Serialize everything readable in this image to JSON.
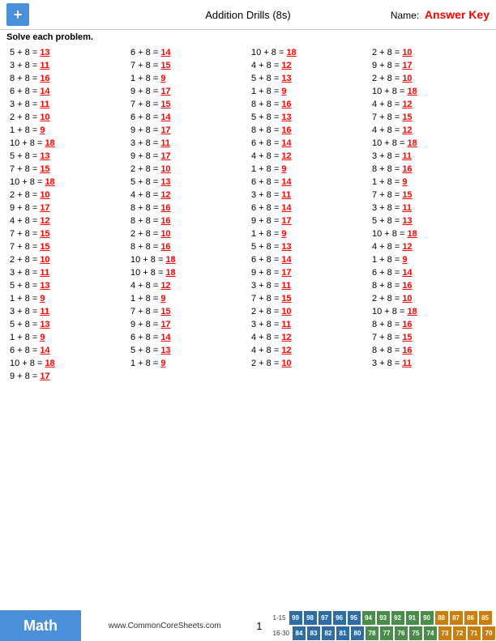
{
  "header": {
    "title": "Addition Drills (8s)",
    "name_label": "Name:",
    "answer_key": "Answer Key",
    "logo_symbol": "+"
  },
  "instruction": "Solve each problem.",
  "problems": [
    {
      "eq": "5 + 8 =",
      "ans": "13"
    },
    {
      "eq": "6 + 8 =",
      "ans": "14"
    },
    {
      "eq": "10 + 8 =",
      "ans": "18"
    },
    {
      "eq": "2 + 8 =",
      "ans": "10"
    },
    {
      "eq": "3 + 8 =",
      "ans": "11"
    },
    {
      "eq": "7 + 8 =",
      "ans": "15"
    },
    {
      "eq": "4 + 8 =",
      "ans": "12"
    },
    {
      "eq": "9 + 8 =",
      "ans": "17"
    },
    {
      "eq": "8 + 8 =",
      "ans": "16"
    },
    {
      "eq": "1 + 8 =",
      "ans": "9"
    },
    {
      "eq": "5 + 8 =",
      "ans": "13"
    },
    {
      "eq": "2 + 8 =",
      "ans": "10"
    },
    {
      "eq": "6 + 8 =",
      "ans": "14"
    },
    {
      "eq": "9 + 8 =",
      "ans": "17"
    },
    {
      "eq": "1 + 8 =",
      "ans": "9"
    },
    {
      "eq": "10 + 8 =",
      "ans": "18"
    },
    {
      "eq": "3 + 8 =",
      "ans": "11"
    },
    {
      "eq": "7 + 8 =",
      "ans": "15"
    },
    {
      "eq": "8 + 8 =",
      "ans": "16"
    },
    {
      "eq": "4 + 8 =",
      "ans": "12"
    },
    {
      "eq": "2 + 8 =",
      "ans": "10"
    },
    {
      "eq": "6 + 8 =",
      "ans": "14"
    },
    {
      "eq": "5 + 8 =",
      "ans": "13"
    },
    {
      "eq": "7 + 8 =",
      "ans": "15"
    },
    {
      "eq": "1 + 8 =",
      "ans": "9"
    },
    {
      "eq": "9 + 8 =",
      "ans": "17"
    },
    {
      "eq": "8 + 8 =",
      "ans": "16"
    },
    {
      "eq": "4 + 8 =",
      "ans": "12"
    },
    {
      "eq": "10 + 8 =",
      "ans": "18"
    },
    {
      "eq": "3 + 8 =",
      "ans": "11"
    },
    {
      "eq": "6 + 8 =",
      "ans": "14"
    },
    {
      "eq": "10 + 8 =",
      "ans": "18"
    },
    {
      "eq": "5 + 8 =",
      "ans": "13"
    },
    {
      "eq": "9 + 8 =",
      "ans": "17"
    },
    {
      "eq": "4 + 8 =",
      "ans": "12"
    },
    {
      "eq": "3 + 8 =",
      "ans": "11"
    },
    {
      "eq": "7 + 8 =",
      "ans": "15"
    },
    {
      "eq": "2 + 8 =",
      "ans": "10"
    },
    {
      "eq": "1 + 8 =",
      "ans": "9"
    },
    {
      "eq": "8 + 8 =",
      "ans": "16"
    },
    {
      "eq": "10 + 8 =",
      "ans": "18"
    },
    {
      "eq": "5 + 8 =",
      "ans": "13"
    },
    {
      "eq": "6 + 8 =",
      "ans": "14"
    },
    {
      "eq": "1 + 8 =",
      "ans": "9"
    },
    {
      "eq": "2 + 8 =",
      "ans": "10"
    },
    {
      "eq": "4 + 8 =",
      "ans": "12"
    },
    {
      "eq": "3 + 8 =",
      "ans": "11"
    },
    {
      "eq": "7 + 8 =",
      "ans": "15"
    },
    {
      "eq": "9 + 8 =",
      "ans": "17"
    },
    {
      "eq": "8 + 8 =",
      "ans": "16"
    },
    {
      "eq": "6 + 8 =",
      "ans": "14"
    },
    {
      "eq": "3 + 8 =",
      "ans": "11"
    },
    {
      "eq": "4 + 8 =",
      "ans": "12"
    },
    {
      "eq": "8 + 8 =",
      "ans": "16"
    },
    {
      "eq": "9 + 8 =",
      "ans": "17"
    },
    {
      "eq": "5 + 8 =",
      "ans": "13"
    },
    {
      "eq": "7 + 8 =",
      "ans": "15"
    },
    {
      "eq": "2 + 8 =",
      "ans": "10"
    },
    {
      "eq": "1 + 8 =",
      "ans": "9"
    },
    {
      "eq": "10 + 8 =",
      "ans": "18"
    },
    {
      "eq": "7 + 8 =",
      "ans": "15"
    },
    {
      "eq": "8 + 8 =",
      "ans": "16"
    },
    {
      "eq": "5 + 8 =",
      "ans": "13"
    },
    {
      "eq": "4 + 8 =",
      "ans": "12"
    },
    {
      "eq": "2 + 8 =",
      "ans": "10"
    },
    {
      "eq": "10 + 8 =",
      "ans": "18"
    },
    {
      "eq": "6 + 8 =",
      "ans": "14"
    },
    {
      "eq": "1 + 8 =",
      "ans": "9"
    },
    {
      "eq": "3 + 8 =",
      "ans": "11"
    },
    {
      "eq": "10 + 8 =",
      "ans": "18"
    },
    {
      "eq": "9 + 8 =",
      "ans": "17"
    },
    {
      "eq": "6 + 8 =",
      "ans": "14"
    },
    {
      "eq": "5 + 8 =",
      "ans": "13"
    },
    {
      "eq": "4 + 8 =",
      "ans": "12"
    },
    {
      "eq": "3 + 8 =",
      "ans": "11"
    },
    {
      "eq": "8 + 8 =",
      "ans": "16"
    },
    {
      "eq": "1 + 8 =",
      "ans": "9"
    },
    {
      "eq": "1 + 8 =",
      "ans": "9"
    },
    {
      "eq": "7 + 8 =",
      "ans": "15"
    },
    {
      "eq": "2 + 8 =",
      "ans": "10"
    },
    {
      "eq": "3 + 8 =",
      "ans": "11"
    },
    {
      "eq": "7 + 8 =",
      "ans": "15"
    },
    {
      "eq": "2 + 8 =",
      "ans": "10"
    },
    {
      "eq": "10 + 8 =",
      "ans": "18"
    },
    {
      "eq": "5 + 8 =",
      "ans": "13"
    },
    {
      "eq": "9 + 8 =",
      "ans": "17"
    },
    {
      "eq": "3 + 8 =",
      "ans": "11"
    },
    {
      "eq": "8 + 8 =",
      "ans": "16"
    },
    {
      "eq": "1 + 8 =",
      "ans": "9"
    },
    {
      "eq": "6 + 8 =",
      "ans": "14"
    },
    {
      "eq": "4 + 8 =",
      "ans": "12"
    },
    {
      "eq": "7 + 8 =",
      "ans": "15"
    },
    {
      "eq": "6 + 8 =",
      "ans": "14"
    },
    {
      "eq": "5 + 8 =",
      "ans": "13"
    },
    {
      "eq": "4 + 8 =",
      "ans": "12"
    },
    {
      "eq": "8 + 8 =",
      "ans": "16"
    },
    {
      "eq": "10 + 8 =",
      "ans": "18"
    },
    {
      "eq": "1 + 8 =",
      "ans": "9"
    },
    {
      "eq": "2 + 8 =",
      "ans": "10"
    },
    {
      "eq": "3 + 8 =",
      "ans": "11"
    },
    {
      "eq": "9 + 8 =",
      "ans": "17"
    }
  ],
  "footer": {
    "math_label": "Math",
    "url": "www.CommonCoreSheets.com",
    "page": "1",
    "score_ranges": [
      {
        "label": "1-15",
        "scores": [
          99,
          98,
          97,
          96,
          95,
          94,
          93,
          92,
          91,
          90,
          88,
          87,
          86,
          85
        ]
      },
      {
        "label": "16-30",
        "scores": [
          84,
          83,
          82,
          81,
          80,
          78,
          77,
          76,
          75,
          74,
          73,
          72,
          71,
          70
        ]
      }
    ],
    "score_colors": [
      "#4a90d9",
      "#4a90d9",
      "#4a90d9",
      "#4a90d9",
      "#4a90d9",
      "#5ba85c",
      "#5ba85c",
      "#5ba85c",
      "#5ba85c",
      "#5ba85c",
      "#e8a020",
      "#e8a020",
      "#e8a020",
      "#e8a020"
    ]
  }
}
